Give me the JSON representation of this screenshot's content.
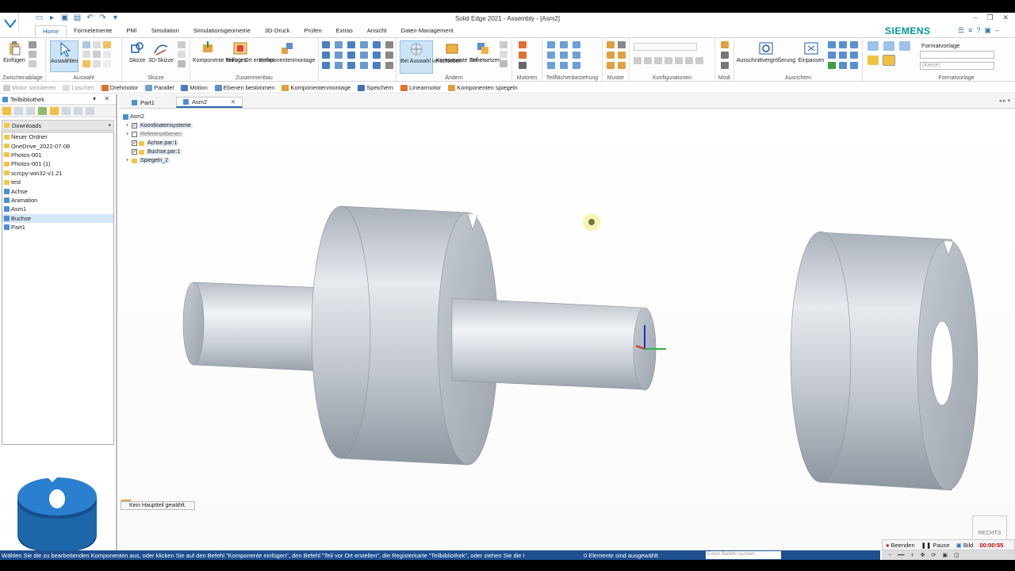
{
  "window": {
    "title": "Solid Edge 2021 - Assembly - [Asm2]"
  },
  "ribbon": {
    "tabs": [
      "Home",
      "Formelemente",
      "PMI",
      "Simulation",
      "Simulationsgeometrie",
      "3D-Druck",
      "Prüfen",
      "Extras",
      "Ansicht",
      "Daten-Management"
    ],
    "brand": "SIEMENS",
    "groups": {
      "zwischenablage": {
        "label": "Zwischenablage",
        "einfuegen": "Einfügen"
      },
      "auswahl": {
        "label": "Auswahl",
        "auswaehlen": "Auswählen"
      },
      "skizze": {
        "label": "Skizze",
        "skizze": "Skizze",
        "skizze3d": "3D-Skizze"
      },
      "zusammenbau": {
        "label": "Zusammenbau",
        "komp_einfuegen": "Komponente einfügen",
        "teil_vor_ort": "Teil vor Ort erstellen",
        "komponentenmontage": "Komponentenmontage"
      },
      "aendern": {
        "label": "Ändern",
        "bei_auswahl": "Bei Auswahl verschieben",
        "komp_ziehen": "Komponente ziehen",
        "teil_ersetzen": "Teil ersetzen"
      },
      "motoren": {
        "label": "Motoren"
      },
      "teilflaechen": {
        "label": "Teilflächenbeziehung"
      },
      "muster": {
        "label": "Muster"
      },
      "konfigurationen": {
        "label": "Konfigurationen"
      },
      "modi": {
        "label": "Modi"
      },
      "ausrichten": {
        "label": "Ausrichten",
        "ausschnitt": "Ausschnittvergrößerung",
        "einpassen": "Einpassen"
      },
      "formatvorlage": {
        "label": "Formatvorlage",
        "title": "Formatvorlage",
        "value": "(Keine)"
      }
    }
  },
  "commandbar": {
    "items": [
      "Motor simulieren",
      "Löschen",
      "Drehmotor",
      "Parallel",
      "Motion",
      "Ebenen bestimmen",
      "Komponentenmontage",
      "Speichern",
      "Linearmotor",
      "Komponenten spiegeln"
    ]
  },
  "library": {
    "title": "Teilbibliothek",
    "folder": "Downloads",
    "items": [
      "Neuer Ordner",
      "OneDrive_2022-07-08",
      "Photos-001",
      "Photos-001 (1)",
      "scrcpy-win32-v1.21",
      "test",
      "Achse",
      "Animation",
      "Asm1",
      "Buchse",
      "Part1"
    ]
  },
  "doctabs": [
    "Part1",
    "Asm2"
  ],
  "tree": {
    "root": "Asm2",
    "nodes": [
      "Koordinatensysteme",
      "Referenzebenen",
      "Achse.par:1",
      "Buchse.par:1",
      "Spiegeln_2"
    ]
  },
  "viewport": {
    "notice": "Kein Hauptteil gewählt.",
    "viewcube": "RECHTS"
  },
  "status": {
    "message": "Wählen Sie die zu bearbeitenden Komponenten aus, oder klicken Sie auf den Befehl \"Komponente einfügen\", den Befehl \"Teil vor Ort erstellen\", die Registerkarte \"Teilbibliothek\", oder ziehen Sie die I",
    "count": "0 Elemente sind ausgewählt",
    "search_placeholder": "Einen Befehl suchen"
  },
  "recorder": {
    "stop": "Beenden",
    "pause": "Pause",
    "image": "Bild",
    "time": "00:00:55"
  },
  "colors": {
    "accent": "#1a5ea8",
    "brand": "#009999",
    "status": "#1e4f8f",
    "part": "#c9ced5",
    "preview": "#1f6fb8"
  }
}
